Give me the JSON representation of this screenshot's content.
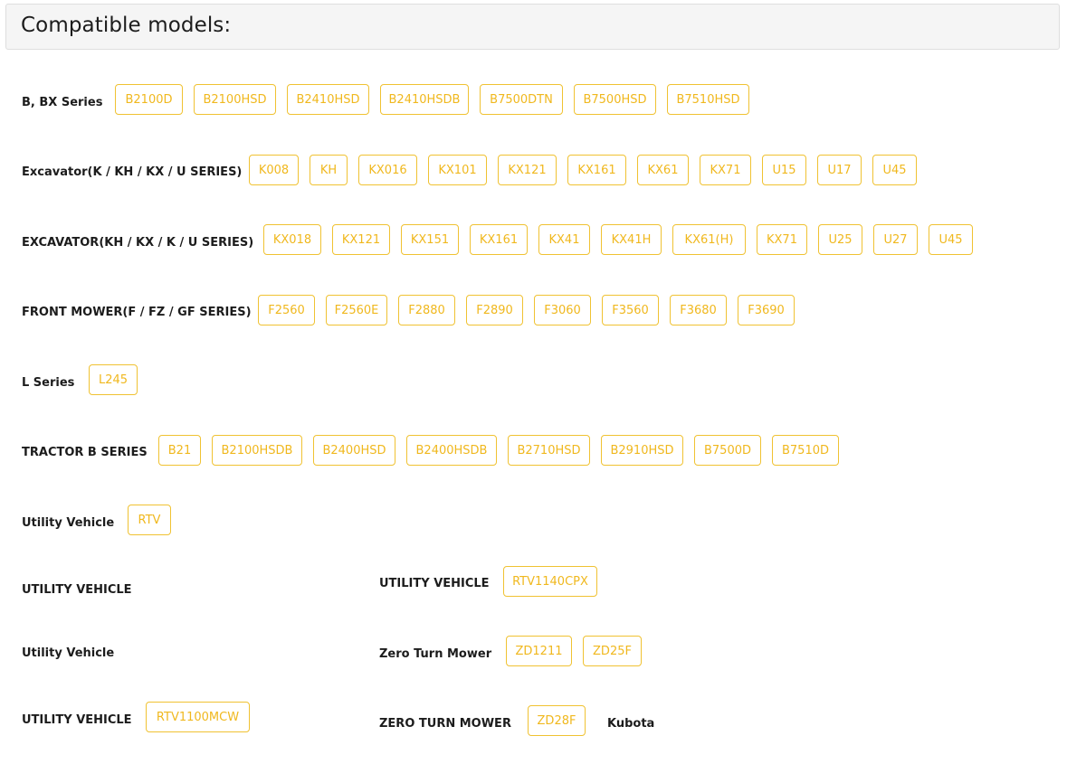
{
  "header": {
    "title": "Compatible models:"
  },
  "series": [
    {
      "label": "B, BX Series",
      "models": [
        "B2100D",
        "B2100HSD",
        "B2410HSD",
        "B2410HSDB",
        "B7500DTN",
        "B7500HSD",
        "B7510HSD"
      ]
    },
    {
      "label": "Excavator(K / KH / KX / U SERIES)",
      "models": [
        "K008",
        "KH",
        "KX016",
        "KX101",
        "KX121",
        "KX161",
        "KX61",
        "KX71",
        "U15",
        "U17",
        "U45"
      ]
    },
    {
      "label": "EXCAVATOR(KH / KX / K / U SERIES)",
      "models": [
        "KX018",
        "KX121",
        "KX151",
        "KX161",
        "KX41",
        "KX41H",
        "KX61(H)",
        "KX71",
        "U25",
        "U27",
        "U45"
      ]
    },
    {
      "label": "FRONT MOWER(F / FZ / GF SERIES)",
      "models": [
        "F2560",
        "F2560E",
        "F2880",
        "F2890",
        "F3060",
        "F3560",
        "F3680",
        "F3690"
      ]
    },
    {
      "label": "L Series",
      "models": [
        "L245"
      ]
    },
    {
      "label": "TRACTOR B SERIES",
      "models": [
        "B21",
        "B2100HSDB",
        "B2400HSD",
        "B2400HSDB",
        "B2710HSD",
        "B2910HSD",
        "B7500D",
        "B7510D"
      ]
    },
    {
      "label": "Utility Vehicle",
      "models": [
        "RTV"
      ]
    },
    {
      "label": "UTILITY VEHICLE",
      "models": []
    },
    {
      "label": "UTILITY VEHICLE",
      "models": [
        "RTV1140CPX"
      ]
    },
    {
      "label": "Utility Vehicle",
      "models": []
    },
    {
      "label": "Zero Turn Mower",
      "models": [
        "ZD1211",
        "ZD25F"
      ]
    },
    {
      "label": "UTILITY VEHICLE",
      "models": [
        "RTV1100MCW"
      ]
    },
    {
      "label": "ZERO TURN MOWER",
      "models": [
        "ZD28F"
      ]
    },
    {
      "label": "Kubota",
      "models": []
    }
  ]
}
